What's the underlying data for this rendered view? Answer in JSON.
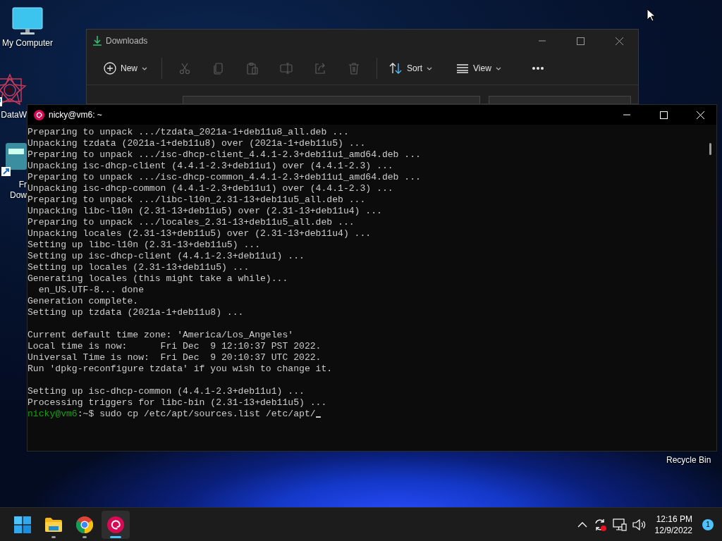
{
  "desktop": {
    "icons": [
      {
        "kind": "computer",
        "lines": [
          "My Computer"
        ]
      },
      {
        "kind": "art-shortcut",
        "lines": [
          "DataW"
        ]
      },
      {
        "kind": "app-shortcut",
        "lines": [
          "Fr",
          "Dow"
        ]
      }
    ],
    "recycle_bin_label": "Recycle Bin"
  },
  "explorer": {
    "title": "Downloads",
    "toolbar": [
      {
        "kind": "new",
        "label": "New",
        "disabled": false
      },
      {
        "kind": "cut",
        "disabled": true
      },
      {
        "kind": "copy",
        "disabled": true
      },
      {
        "kind": "paste",
        "disabled": true
      },
      {
        "kind": "rename",
        "disabled": true
      },
      {
        "kind": "share",
        "disabled": true
      },
      {
        "kind": "delete",
        "disabled": true
      },
      {
        "kind": "sort",
        "label": "Sort",
        "disabled": false
      },
      {
        "kind": "view",
        "label": "View",
        "disabled": false
      },
      {
        "kind": "more",
        "disabled": false
      }
    ]
  },
  "terminal": {
    "title": "nicky@vm6: ~",
    "lines": [
      {
        "kind": "output",
        "text": "Preparing to unpack .../tzdata_2021a-1+deb11u8_all.deb ..."
      },
      {
        "kind": "output",
        "text": "Unpacking tzdata (2021a-1+deb11u8) over (2021a-1+deb11u5) ..."
      },
      {
        "kind": "output",
        "text": "Preparing to unpack .../isc-dhcp-client_4.4.1-2.3+deb11u1_amd64.deb ..."
      },
      {
        "kind": "output",
        "text": "Unpacking isc-dhcp-client (4.4.1-2.3+deb11u1) over (4.4.1-2.3) ..."
      },
      {
        "kind": "output",
        "text": "Preparing to unpack .../isc-dhcp-common_4.4.1-2.3+deb11u1_amd64.deb ..."
      },
      {
        "kind": "output",
        "text": "Unpacking isc-dhcp-common (4.4.1-2.3+deb11u1) over (4.4.1-2.3) ..."
      },
      {
        "kind": "output",
        "text": "Preparing to unpack .../libc-l10n_2.31-13+deb11u5_all.deb ..."
      },
      {
        "kind": "output",
        "text": "Unpacking libc-l10n (2.31-13+deb11u5) over (2.31-13+deb11u4) ..."
      },
      {
        "kind": "output",
        "text": "Preparing to unpack .../locales_2.31-13+deb11u5_all.deb ..."
      },
      {
        "kind": "output",
        "text": "Unpacking locales (2.31-13+deb11u5) over (2.31-13+deb11u4) ..."
      },
      {
        "kind": "output",
        "text": "Setting up libc-l10n (2.31-13+deb11u5) ..."
      },
      {
        "kind": "output",
        "text": "Setting up isc-dhcp-client (4.4.1-2.3+deb11u1) ..."
      },
      {
        "kind": "output",
        "text": "Setting up locales (2.31-13+deb11u5) ..."
      },
      {
        "kind": "output",
        "text": "Generating locales (this might take a while)..."
      },
      {
        "kind": "output",
        "text": "  en_US.UTF-8... done"
      },
      {
        "kind": "output",
        "text": "Generation complete."
      },
      {
        "kind": "output",
        "text": "Setting up tzdata (2021a-1+deb11u8) ..."
      },
      {
        "kind": "blank"
      },
      {
        "kind": "output",
        "text": "Current default time zone: 'America/Los_Angeles'"
      },
      {
        "kind": "output",
        "text": "Local time is now:      Fri Dec  9 12:10:37 PST 2022."
      },
      {
        "kind": "output",
        "text": "Universal Time is now:  Fri Dec  9 20:10:37 UTC 2022."
      },
      {
        "kind": "output",
        "text": "Run 'dpkg-reconfigure tzdata' if you wish to change it."
      },
      {
        "kind": "blank"
      },
      {
        "kind": "output",
        "text": "Setting up isc-dhcp-common (4.4.1-2.3+deb11u1) ..."
      },
      {
        "kind": "output",
        "text": "Processing triggers for libc-bin (2.31-13+deb11u5) ..."
      },
      {
        "kind": "prompt",
        "user": "nicky@vm6",
        "path": ":~$",
        "command": "sudo cp /etc/apt/sources.list /etc/apt/"
      }
    ]
  },
  "taskbar": {
    "apps": [
      {
        "kind": "start",
        "running": false,
        "selected": false
      },
      {
        "kind": "files",
        "running": true,
        "selected": false
      },
      {
        "kind": "browser",
        "running": true,
        "selected": false
      },
      {
        "kind": "debian",
        "running": true,
        "selected": true
      }
    ],
    "time": "12:16 PM",
    "date": "12/9/2022",
    "notifications": "1"
  }
}
